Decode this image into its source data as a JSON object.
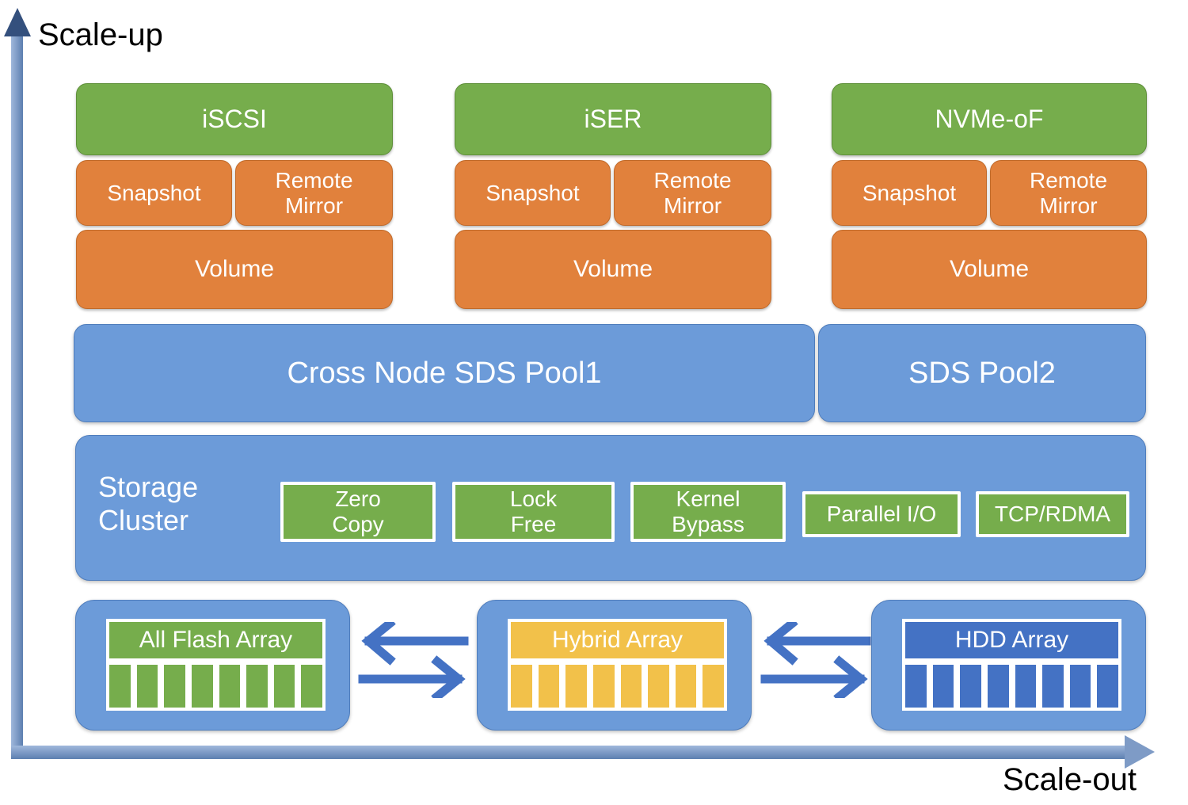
{
  "axes": {
    "vertical_label": "Scale-up",
    "horizontal_label": "Scale-out",
    "axis_color": "#6C9BD9",
    "arrow_head_color": "#34507D"
  },
  "colors": {
    "protocol_green": "#76AD4C",
    "service_orange": "#E1813C",
    "pool_blue": "#6C9BD9",
    "flash_green": "#76AD4C",
    "hybrid_yellow": "#F2C14A",
    "hdd_blue": "#4472C4",
    "arrow_blue": "#4472C4"
  },
  "stacks": [
    {
      "protocol": "iSCSI",
      "services": [
        "Snapshot",
        "Remote\nMirror"
      ],
      "volume": "Volume"
    },
    {
      "protocol": "iSER",
      "services": [
        "Snapshot",
        "Remote\nMirror"
      ],
      "volume": "Volume"
    },
    {
      "protocol": "NVMe-oF",
      "services": [
        "Snapshot",
        "Remote\nMirror"
      ],
      "volume": "Volume"
    }
  ],
  "pools": [
    {
      "label": "Cross Node SDS Pool1"
    },
    {
      "label": "SDS Pool2"
    }
  ],
  "storage_cluster": {
    "label": "Storage\nCluster",
    "features": [
      "Zero\nCopy",
      "Lock\nFree",
      "Kernel\nBypass",
      "Parallel I/O",
      "TCP/RDMA"
    ]
  },
  "arrays": [
    {
      "title": "All Flash Array",
      "drive_count": 8,
      "tier": "flash"
    },
    {
      "title": "Hybrid Array",
      "drive_count": 8,
      "tier": "hybrid"
    },
    {
      "title": "HDD Array",
      "drive_count": 8,
      "tier": "hdd"
    }
  ],
  "exchange_arrows": [
    {
      "label": "bidirectional-exchange"
    },
    {
      "label": "bidirectional-exchange"
    }
  ]
}
